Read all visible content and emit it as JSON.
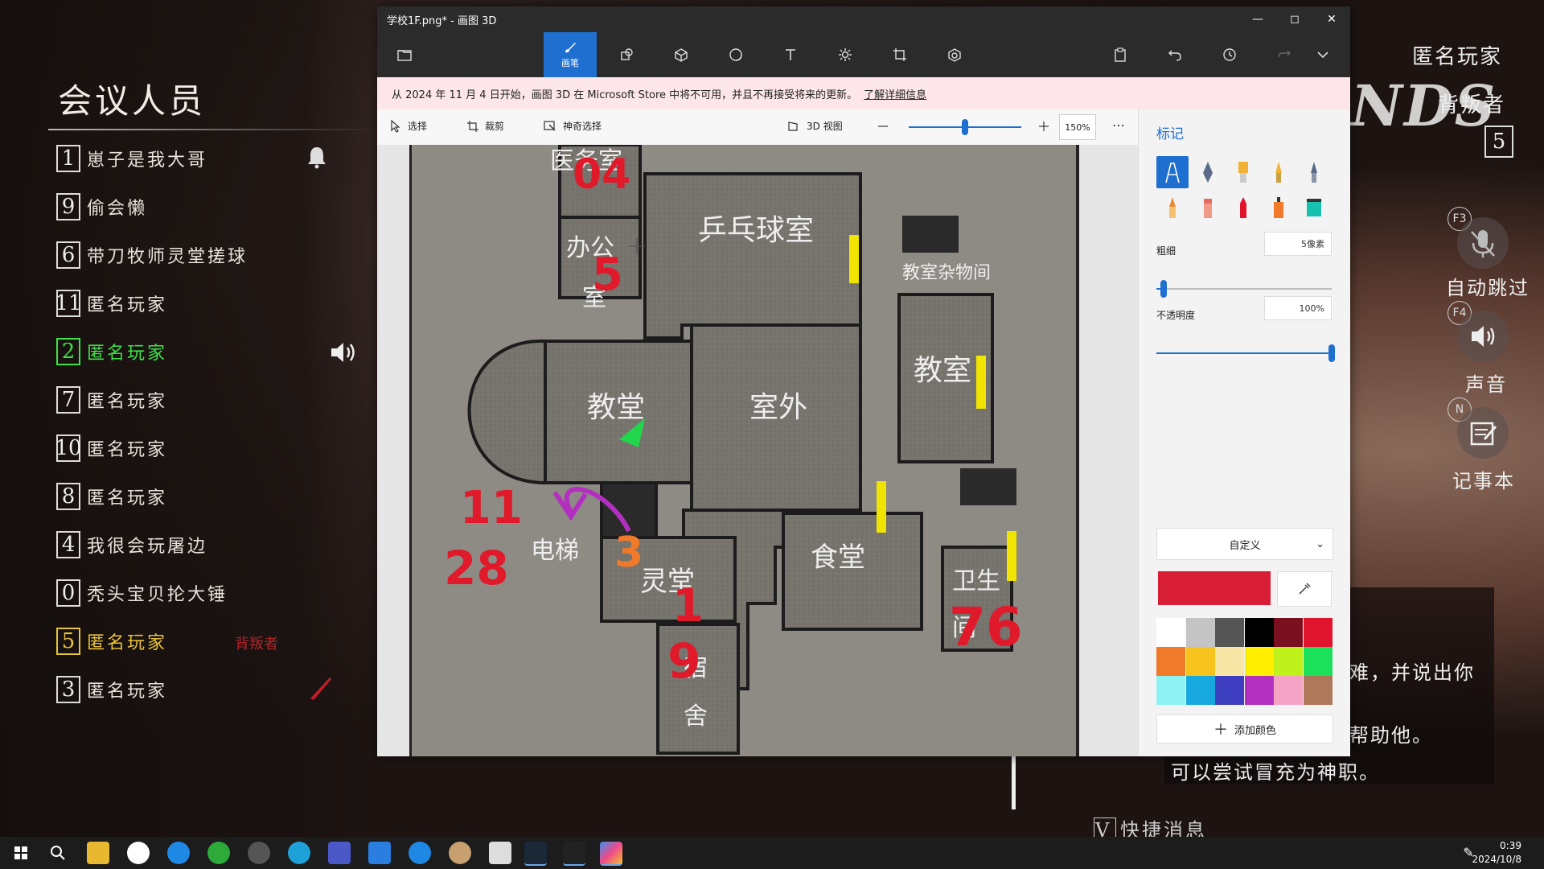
{
  "game": {
    "panel_title": "会议人员",
    "members": [
      {
        "num": "1",
        "name": "崽子是我大哥"
      },
      {
        "num": "9",
        "name": "偷会懒"
      },
      {
        "num": "6",
        "name": "带刀牧师灵堂搓球"
      },
      {
        "num": "11",
        "name": "匿名玩家"
      },
      {
        "num": "2",
        "name": "匿名玩家"
      },
      {
        "num": "7",
        "name": "匿名玩家"
      },
      {
        "num": "10",
        "name": "匿名玩家"
      },
      {
        "num": "8",
        "name": "匿名玩家"
      },
      {
        "num": "4",
        "name": "我很会玩屠边"
      },
      {
        "num": "0",
        "name": "秃头宝贝抡大锤"
      },
      {
        "num": "5",
        "name": "匿名玩家"
      },
      {
        "num": "3",
        "name": "匿名玩家"
      }
    ],
    "traitor_tag": "背叛者",
    "hud": {
      "player_name": "匿名玩家",
      "brand": "NDS",
      "traitor_label": "背叛者",
      "traitor_count": "5",
      "key_f3": "F3",
      "auto_skip": "自动跳过",
      "key_f4": "F4",
      "sound": "声音",
      "key_n": "N",
      "notepad": "记事本"
    },
    "chat": {
      "line1": "难，并说出你",
      "line2": "帮助他。",
      "line3": "可以尝试冒充为神职。"
    },
    "quick_message_key": "V",
    "quick_message": "快捷消息"
  },
  "paint": {
    "window_title": "学校1F.png* - 画图 3D",
    "active_tool_label": "画笔",
    "notice_text": "从 2024 年 11 月 4 日开始，画图 3D 在 Microsoft Store 中将不可用，并且不再接受将来的更新。",
    "notice_link": "了解详细信息",
    "subbar": {
      "select": "选择",
      "crop": "裁剪",
      "magic_select": "神奇选择",
      "view3d": "3D 视图",
      "zoom": "150%"
    },
    "side": {
      "title": "标记",
      "thickness_label": "粗细",
      "thickness_value": "5像素",
      "thickness_level": 0.04,
      "opacity_label": "不透明度",
      "opacity_value": "100%",
      "opacity_level": 1.0,
      "color_mode": "自定义",
      "add_color": "添加颜色",
      "current_color": "#d81e34",
      "swatches": [
        "#ffffff",
        "#c4c4c4",
        "#555555",
        "#000000",
        "#7a0f1f",
        "#e0142d",
        "#f07a2a",
        "#f6c21c",
        "#f7e6a6",
        "#ffee00",
        "#bff21c",
        "#1ce05a",
        "#8ef2f2",
        "#18a8e0",
        "#3d3fc0",
        "#b22fc0",
        "#f4a3c4",
        "#b0785a"
      ]
    },
    "map": {
      "rooms": {
        "medical": "医务室",
        "pingpong": "乒乓球室",
        "office": "办公",
        "office2": "室",
        "storage": "教室杂物间",
        "church": "教堂",
        "outside": "室外",
        "classroom": "教室",
        "elevator": "电梯",
        "shrine": "灵堂",
        "canteen": "食堂",
        "toilet": "卫生",
        "toilet2": "间",
        "dorm": "宿",
        "dorm2": "舍"
      },
      "marks": {
        "m04": "04",
        "m5": "5",
        "m3": "3",
        "m11": "11",
        "m28": "28",
        "m1": "1",
        "m9": "9",
        "m76": "76"
      }
    }
  },
  "taskbar": {
    "time": "0:39",
    "date": "2024/10/8"
  }
}
